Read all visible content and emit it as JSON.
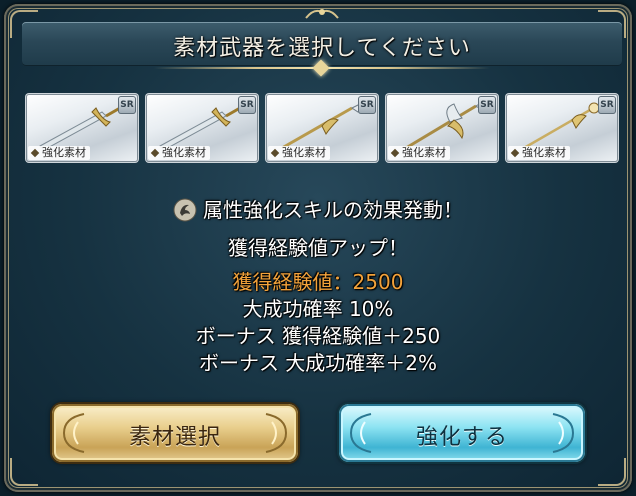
{
  "dialog": {
    "title": "素材武器を選択してください"
  },
  "materials": [
    {
      "rarity": "SR",
      "tag": "強化素材",
      "icon": "sword-icon"
    },
    {
      "rarity": "SR",
      "tag": "強化素材",
      "icon": "sword-icon"
    },
    {
      "rarity": "SR",
      "tag": "強化素材",
      "icon": "spear-icon"
    },
    {
      "rarity": "SR",
      "tag": "強化素材",
      "icon": "halberd-icon"
    },
    {
      "rarity": "SR",
      "tag": "強化素材",
      "icon": "staff-icon"
    }
  ],
  "messages": {
    "skill": "属性強化スキルの効果発動！",
    "bonus": "獲得経験値アップ！",
    "exp": "獲得経験値：2500",
    "great_success_rate": "大成功確率 10%",
    "bonus_exp": "ボーナス 獲得経験値＋250",
    "bonus_rate": "ボーナス 大成功確率＋2%"
  },
  "buttons": {
    "select": "素材選択",
    "enhance": "強化する"
  },
  "colors": {
    "exp_highlight": "#f2a23a",
    "gold_button": "#e9cf8d",
    "blue_button": "#8de3f2"
  }
}
